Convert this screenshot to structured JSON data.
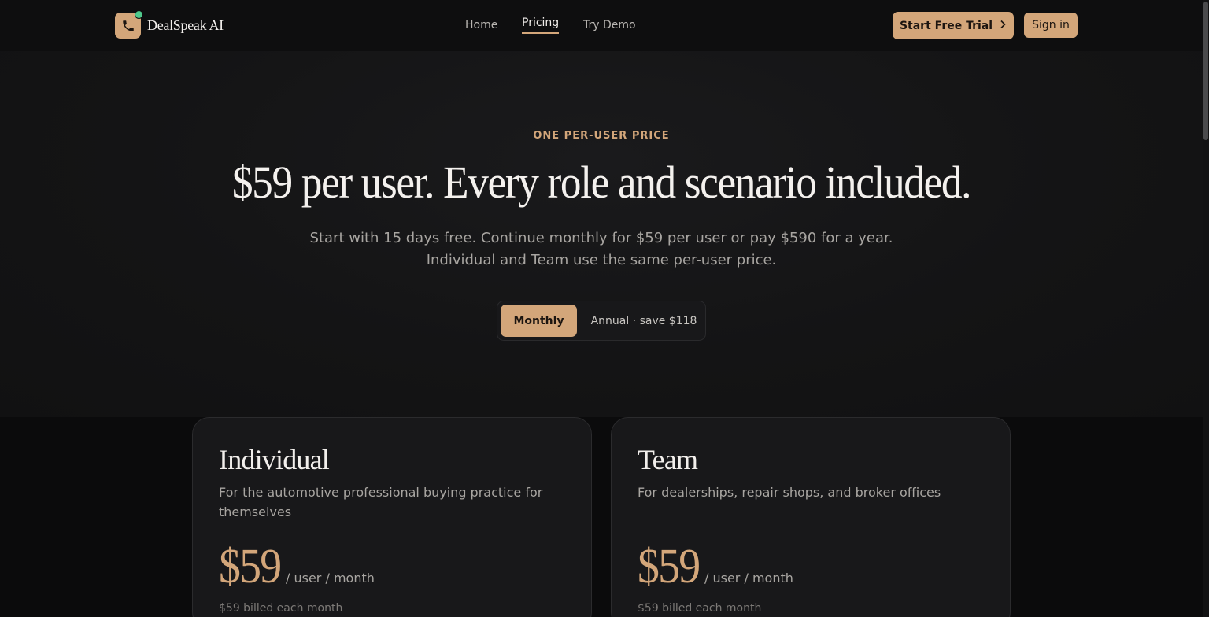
{
  "header": {
    "logo_text": "DealSpeak AI",
    "nav": [
      {
        "label": "Home",
        "active": false
      },
      {
        "label": "Pricing",
        "active": true
      },
      {
        "label": "Try Demo",
        "active": false
      }
    ],
    "cta_label": "Start Free Trial",
    "signin_label": "Sign in"
  },
  "hero": {
    "eyebrow": "ONE PER-USER PRICE",
    "headline": "$59 per user. Every role and scenario included.",
    "sub_line1": "Start with 15 days free. Continue monthly for $59 per user or pay $590 for a year.",
    "sub_line2": "Individual and Team use the same per-user price.",
    "toggle": {
      "monthly_label": "Monthly",
      "annual_label": "Annual · save $118",
      "selected": "Monthly"
    }
  },
  "plans": [
    {
      "name": "Individual",
      "description": "For the automotive professional buying practice for themselves",
      "price": "$59",
      "price_unit": "/ user / month",
      "billing_note": "$59 billed each month"
    },
    {
      "name": "Team",
      "description": "For dealerships, repair shops, and broker offices",
      "price": "$59",
      "price_unit": "/ user / month",
      "billing_note": "$59 billed each month"
    }
  ],
  "colors": {
    "accent": "#d3a67a",
    "background": "#0b0b0c",
    "status_online": "#4fc98c"
  }
}
